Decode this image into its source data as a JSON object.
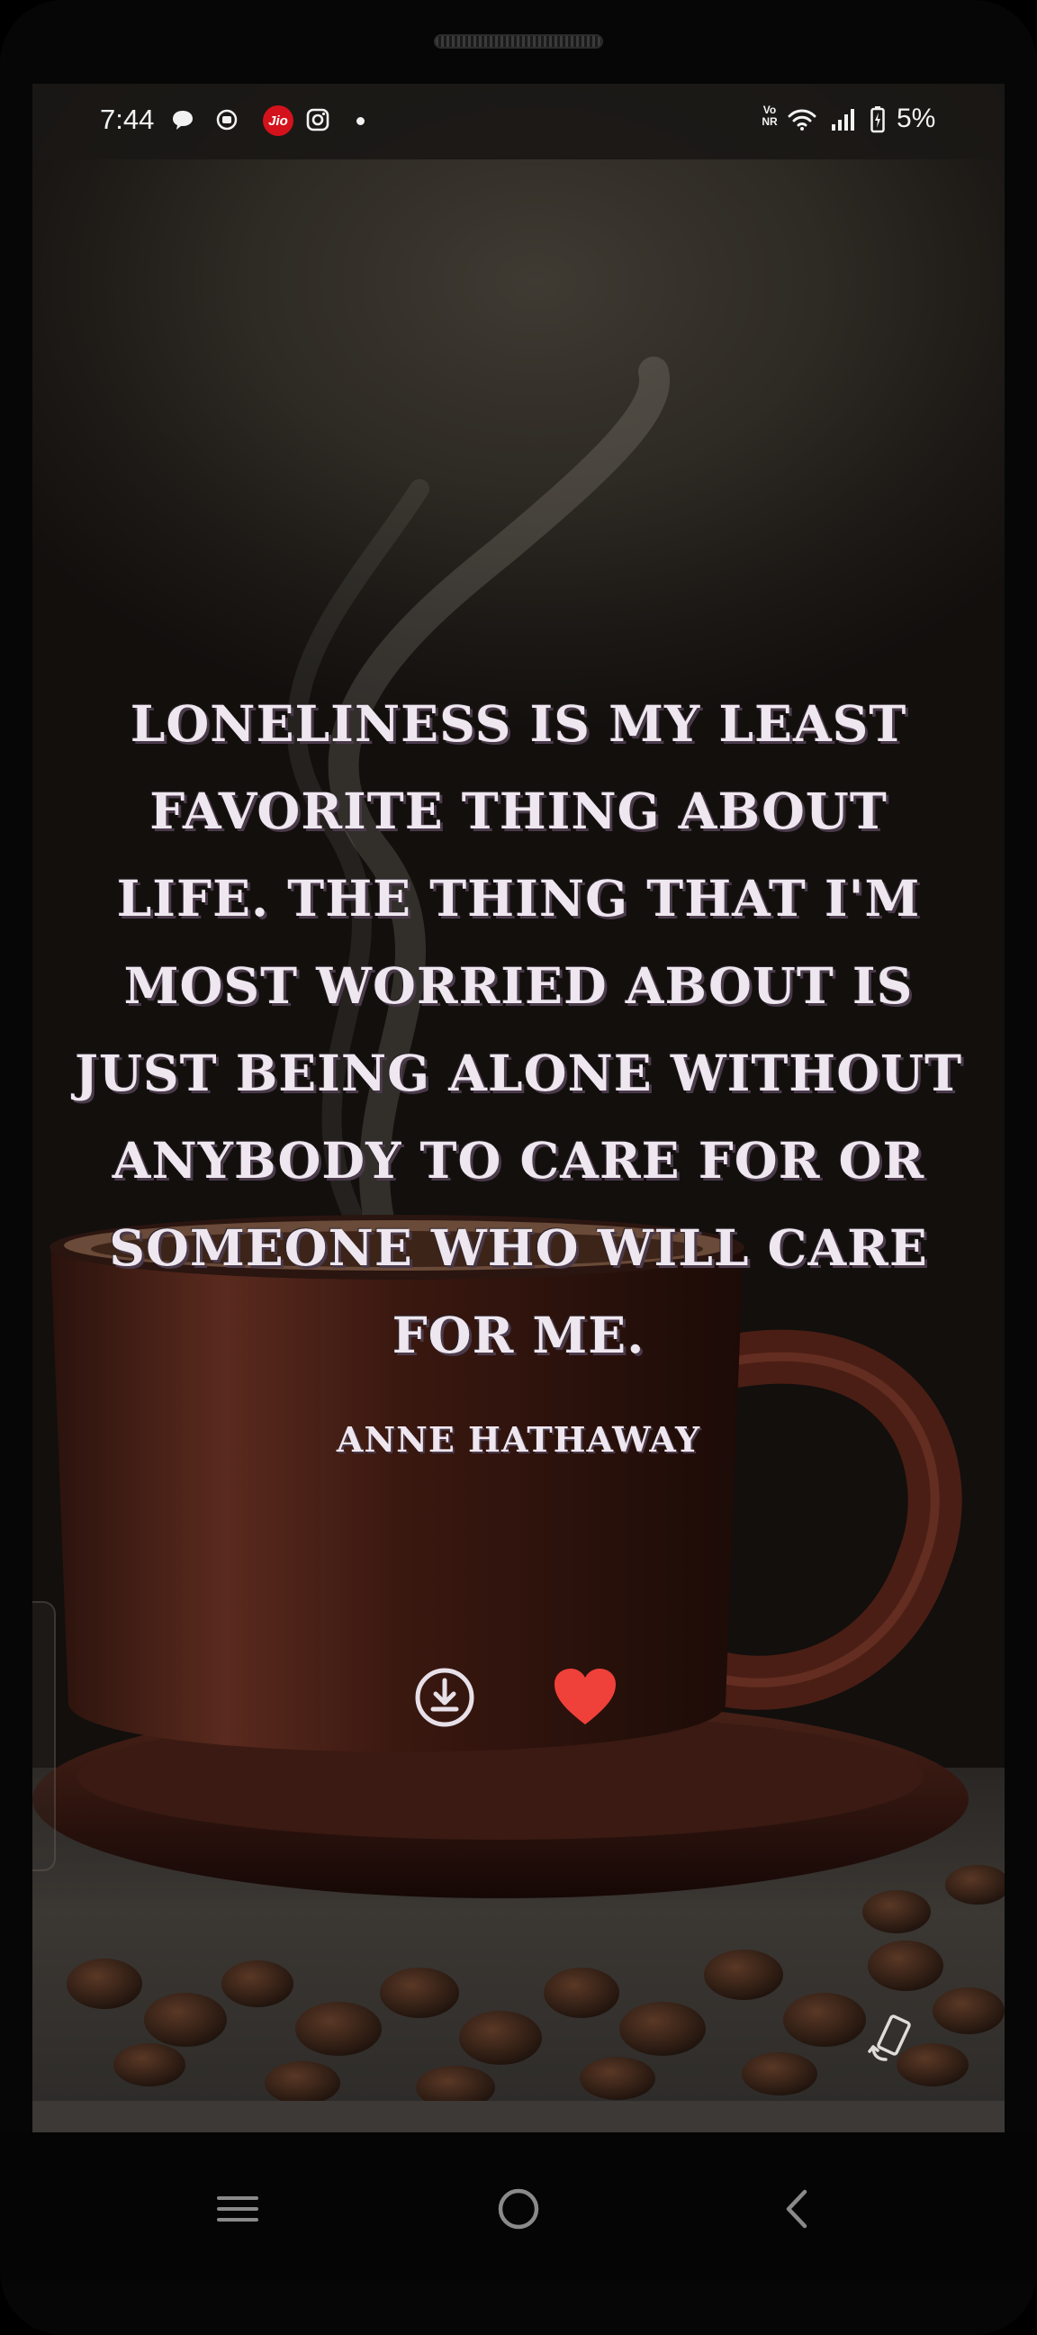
{
  "status_bar": {
    "time": "7:44",
    "jio_label": "Jio",
    "volte_label_top": "Vo",
    "volte_label_bottom": "NR",
    "battery_percent": "5%",
    "icons": [
      "chat-bubble-icon",
      "media-icon",
      "jio-icon",
      "instagram-icon",
      "notification-dot-icon",
      "volte-icon",
      "wifi-icon",
      "signal-icon",
      "battery-icon"
    ]
  },
  "quote": {
    "text": "Loneliness is my least favorite thing about life. The thing that I'm most worried about is just being alone without anybody to care for or someone who will care for me.",
    "author": "Anne Hathaway"
  },
  "actions": {
    "download_icon": "download-icon",
    "like_icon": "heart-icon",
    "like_color": "#f0403a",
    "rotate_icon": "rotate-screen-icon"
  },
  "navigation": {
    "items": [
      "recents-icon",
      "home-icon",
      "back-icon"
    ]
  },
  "colors": {
    "quote_text": "#efe7ef",
    "text_shadow": "#4a3a4a",
    "background_dark": "#1e1a16"
  }
}
